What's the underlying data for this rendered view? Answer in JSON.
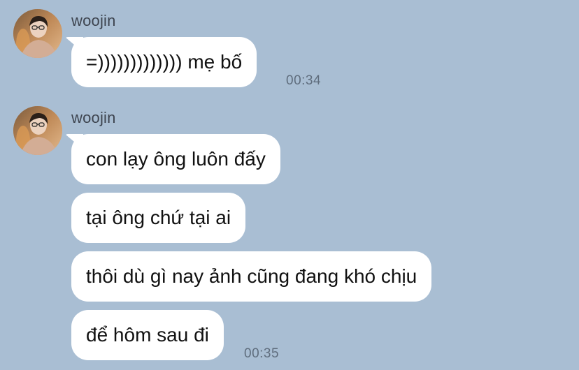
{
  "messages": [
    {
      "sender": "woojin",
      "bubbles": [
        "=))))))))))))) mẹ bố"
      ],
      "time": "00:34"
    },
    {
      "sender": "woojin",
      "bubbles": [
        "con lạy ông luôn đấy",
        "tại ông chứ tại ai",
        "thôi dù gì nay ảnh cũng đang khó chịu",
        "để hôm sau đi"
      ],
      "time": "00:35"
    }
  ],
  "colors": {
    "background": "#a9bed3",
    "bubble": "#ffffff",
    "sender_text": "#3e4550",
    "timestamp_text": "#5f6d7d"
  },
  "icons": {
    "avatar": "avatar-photo"
  }
}
